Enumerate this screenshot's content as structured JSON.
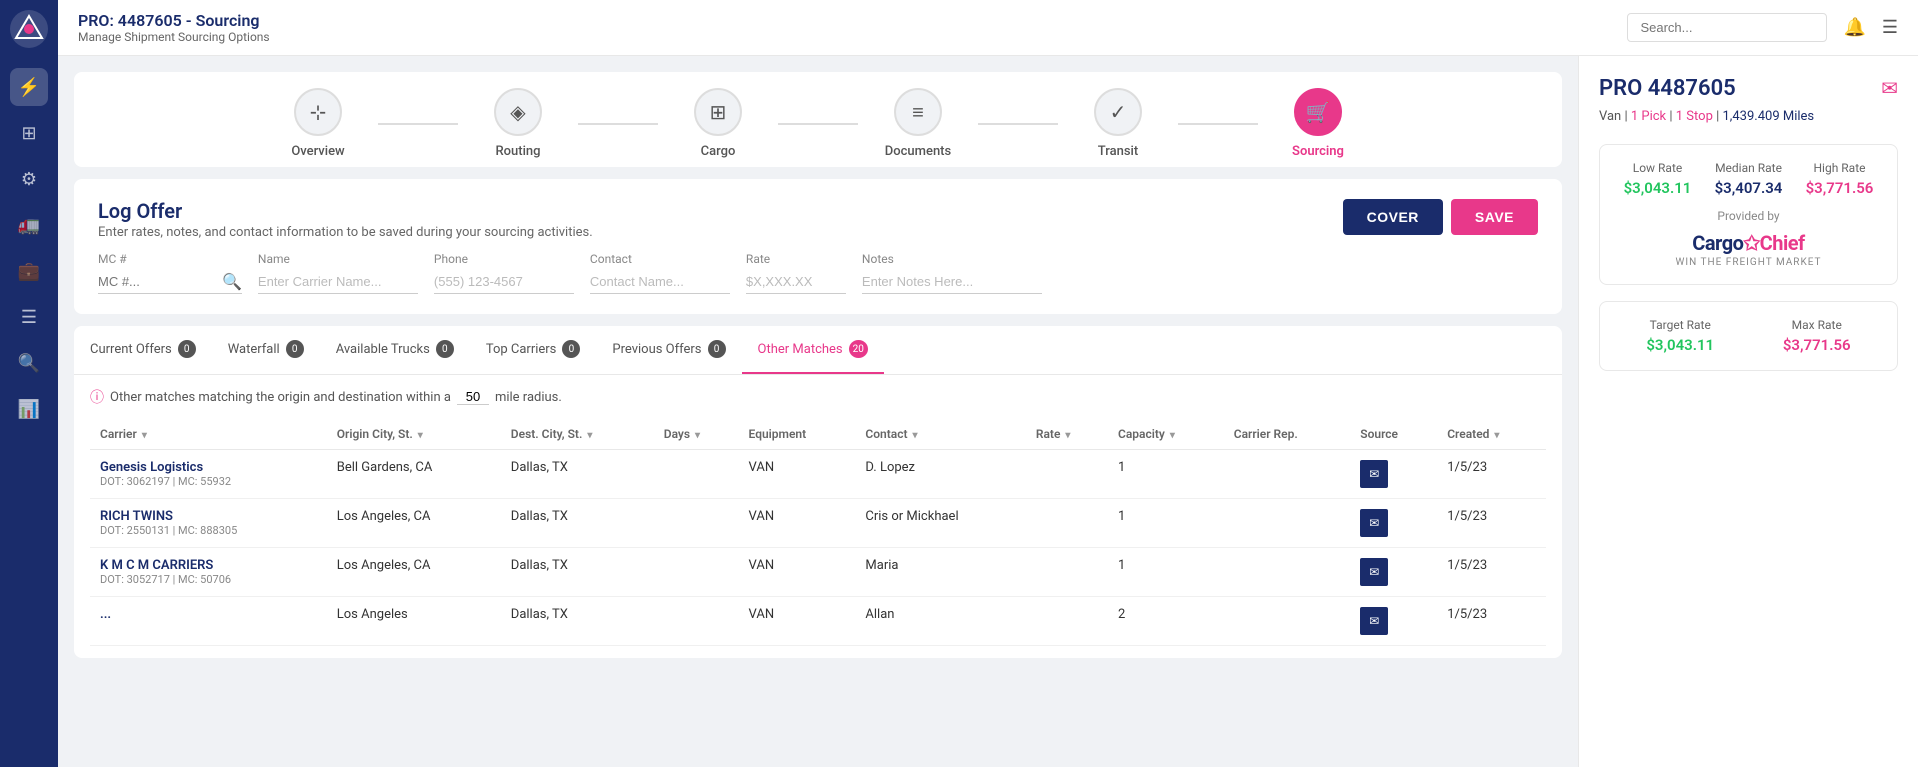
{
  "topbar": {
    "pro_title": "PRO: 4487605 - Sourcing",
    "subtitle": "Manage Shipment Sourcing Options",
    "search_placeholder": "Search..."
  },
  "workflow": {
    "steps": [
      {
        "id": "overview",
        "label": "Overview",
        "icon": "⊹",
        "active": false
      },
      {
        "id": "routing",
        "label": "Routing",
        "icon": "◈",
        "active": false
      },
      {
        "id": "cargo",
        "label": "Cargo",
        "icon": "⊞",
        "active": false
      },
      {
        "id": "documents",
        "label": "Documents",
        "icon": "≡",
        "active": false
      },
      {
        "id": "transit",
        "label": "Transit",
        "icon": "✓",
        "active": false
      },
      {
        "id": "sourcing",
        "label": "Sourcing",
        "icon": "🛒",
        "active": true
      }
    ]
  },
  "log_offer": {
    "title": "Log Offer",
    "subtitle": "Enter rates, notes, and contact information to be saved during your sourcing activities.",
    "btn_cover": "COVER",
    "btn_save": "SAVE",
    "fields": {
      "mc_label": "MC #",
      "mc_placeholder": "MC #...",
      "name_label": "Name",
      "name_placeholder": "Enter Carrier Name...",
      "phone_label": "Phone",
      "phone_placeholder": "(555) 123-4567",
      "contact_label": "Contact",
      "contact_placeholder": "Contact Name...",
      "rate_label": "Rate",
      "rate_placeholder": "$X,XXX.XX",
      "notes_label": "Notes",
      "notes_placeholder": "Enter Notes Here..."
    }
  },
  "tabs": [
    {
      "id": "current-offers",
      "label": "Current Offers",
      "count": 0,
      "active": false
    },
    {
      "id": "waterfall",
      "label": "Waterfall",
      "count": 0,
      "active": false
    },
    {
      "id": "available-trucks",
      "label": "Available Trucks",
      "count": 0,
      "active": false
    },
    {
      "id": "top-carriers",
      "label": "Top Carriers",
      "count": 0,
      "active": false
    },
    {
      "id": "previous-offers",
      "label": "Previous Offers",
      "count": 0,
      "active": false
    },
    {
      "id": "other-matches",
      "label": "Other Matches",
      "count": 20,
      "active": true
    }
  ],
  "other_matches": {
    "info_text": "Other matches matching the origin and destination within a",
    "radius": "50",
    "radius_suffix": "mile radius.",
    "columns": [
      {
        "key": "carrier",
        "label": "Carrier"
      },
      {
        "key": "origin_city",
        "label": "Origin City, St."
      },
      {
        "key": "dest_city",
        "label": "Dest. City, St."
      },
      {
        "key": "days",
        "label": "Days"
      },
      {
        "key": "equipment",
        "label": "Equipment"
      },
      {
        "key": "contact",
        "label": "Contact"
      },
      {
        "key": "rate",
        "label": "Rate"
      },
      {
        "key": "capacity",
        "label": "Capacity"
      },
      {
        "key": "carrier_rep",
        "label": "Carrier Rep."
      },
      {
        "key": "source",
        "label": "Source"
      },
      {
        "key": "created",
        "label": "Created"
      }
    ],
    "rows": [
      {
        "carrier_name": "Genesis Logistics",
        "carrier_dot": "DOT: 3062197 | MC: 55932",
        "origin_city": "Bell Gardens, CA",
        "dest_city": "Dallas, TX",
        "days": "",
        "equipment": "VAN",
        "contact": "D. Lopez",
        "rate": "",
        "capacity": "1",
        "carrier_rep": "",
        "source": "✉",
        "created": "1/5/23"
      },
      {
        "carrier_name": "RICH TWINS",
        "carrier_dot": "DOT: 2550131 | MC: 888305",
        "origin_city": "Los Angeles, CA",
        "dest_city": "Dallas, TX",
        "days": "",
        "equipment": "VAN",
        "contact": "Cris or Mickhael",
        "rate": "",
        "capacity": "1",
        "carrier_rep": "",
        "source": "✉",
        "created": "1/5/23"
      },
      {
        "carrier_name": "K M C M CARRIERS",
        "carrier_dot": "DOT: 3052717 | MC: 50706",
        "origin_city": "Los Angeles, CA",
        "dest_city": "Dallas, TX",
        "days": "",
        "equipment": "VAN",
        "contact": "Maria",
        "rate": "",
        "capacity": "1",
        "carrier_rep": "",
        "source": "✉",
        "created": "1/5/23"
      },
      {
        "carrier_name": "...",
        "carrier_dot": "",
        "origin_city": "Los Angeles",
        "dest_city": "Dallas, TX",
        "days": "",
        "equipment": "VAN",
        "contact": "Allan",
        "rate": "",
        "capacity": "2",
        "carrier_rep": "",
        "source": "✉",
        "created": "1/5/23"
      }
    ]
  },
  "right_panel": {
    "pro_number": "PRO 4487605",
    "meta_type": "Van",
    "meta_picks": "1 Pick",
    "meta_stops": "1 Stop",
    "meta_miles": "1,439.409 Miles",
    "rates": {
      "low_label": "Low Rate",
      "low_value": "$3,043.11",
      "median_label": "Median Rate",
      "median_value": "$3,407.34",
      "high_label": "High Rate",
      "high_value": "$3,771.56"
    },
    "provided_by": "Provided by",
    "cargo_chief_name": "Cargo",
    "cargo_chief_accent": "Chief",
    "cargo_chief_tagline": "WIN THE FREIGHT MARKET",
    "target_rate_label": "Target Rate",
    "target_rate_value": "$3,043.11",
    "max_rate_label": "Max Rate",
    "max_rate_value": "$3,771.56"
  },
  "sidebar": {
    "icons": [
      {
        "id": "analytics",
        "symbol": "⚡"
      },
      {
        "id": "dashboard",
        "symbol": "⊞"
      },
      {
        "id": "tools",
        "symbol": "🔧"
      },
      {
        "id": "truck",
        "symbol": "🚛"
      },
      {
        "id": "briefcase",
        "symbol": "💼"
      },
      {
        "id": "list",
        "symbol": "☰"
      },
      {
        "id": "search",
        "symbol": "🔍"
      },
      {
        "id": "chart",
        "symbol": "📊"
      }
    ]
  }
}
